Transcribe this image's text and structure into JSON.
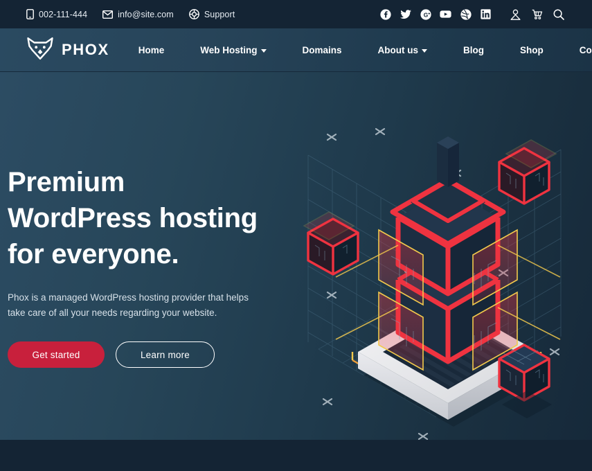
{
  "topbar": {
    "contacts": [
      {
        "icon": "mobile-phone-icon",
        "label": "002-111-444"
      },
      {
        "icon": "envelope-icon",
        "label": "info@site.com"
      },
      {
        "icon": "lifebuoy-icon",
        "label": "Support"
      }
    ],
    "social": [
      {
        "icon": "facebook-icon",
        "label": "Facebook"
      },
      {
        "icon": "twitter-icon",
        "label": "Twitter"
      },
      {
        "icon": "google-plus-icon",
        "label": "Google Plus"
      },
      {
        "icon": "youtube-icon",
        "label": "YouTube"
      },
      {
        "icon": "dribbble-icon",
        "label": "Dribbble"
      },
      {
        "icon": "linkedin-icon",
        "label": "LinkedIn"
      }
    ],
    "utilities": [
      {
        "icon": "user-account-icon",
        "label": "Account"
      },
      {
        "icon": "shopping-cart-icon",
        "label": "Cart"
      },
      {
        "icon": "search-icon",
        "label": "Search"
      }
    ]
  },
  "brand": {
    "name": "PHOX",
    "logo_icon": "fox-head-icon"
  },
  "nav": {
    "items": [
      {
        "label": "Home",
        "has_dropdown": false
      },
      {
        "label": "Web Hosting",
        "has_dropdown": true
      },
      {
        "label": "Domains",
        "has_dropdown": false
      },
      {
        "label": "About us",
        "has_dropdown": true
      },
      {
        "label": "Blog",
        "has_dropdown": false
      },
      {
        "label": "Shop",
        "has_dropdown": false
      },
      {
        "label": "Contact us",
        "has_dropdown": false
      }
    ]
  },
  "hero": {
    "title_lines": [
      "Premium",
      "WordPress hosting",
      "for everyone."
    ],
    "title": "Premium WordPress hosting for everyone.",
    "subtitle": "Phox is a managed WordPress hosting provider that helps take care of all your needs regarding your website.",
    "primary_button": "Get started",
    "secondary_button": "Learn more",
    "illustration_name": "isometric-server-tower-illustration"
  },
  "colors": {
    "topbar_bg": "#142434",
    "nav_bg_left": "#2a4a61",
    "nav_bg_right": "#1b3346",
    "hero_bg_left": "#2c4c63",
    "hero_bg_right": "#16293a",
    "accent_red": "#c8203c",
    "illustration_red": "#ef3340",
    "illustration_yellow": "#f2c94c",
    "text_primary": "#ffffff",
    "text_muted": "#d7e1e9"
  }
}
